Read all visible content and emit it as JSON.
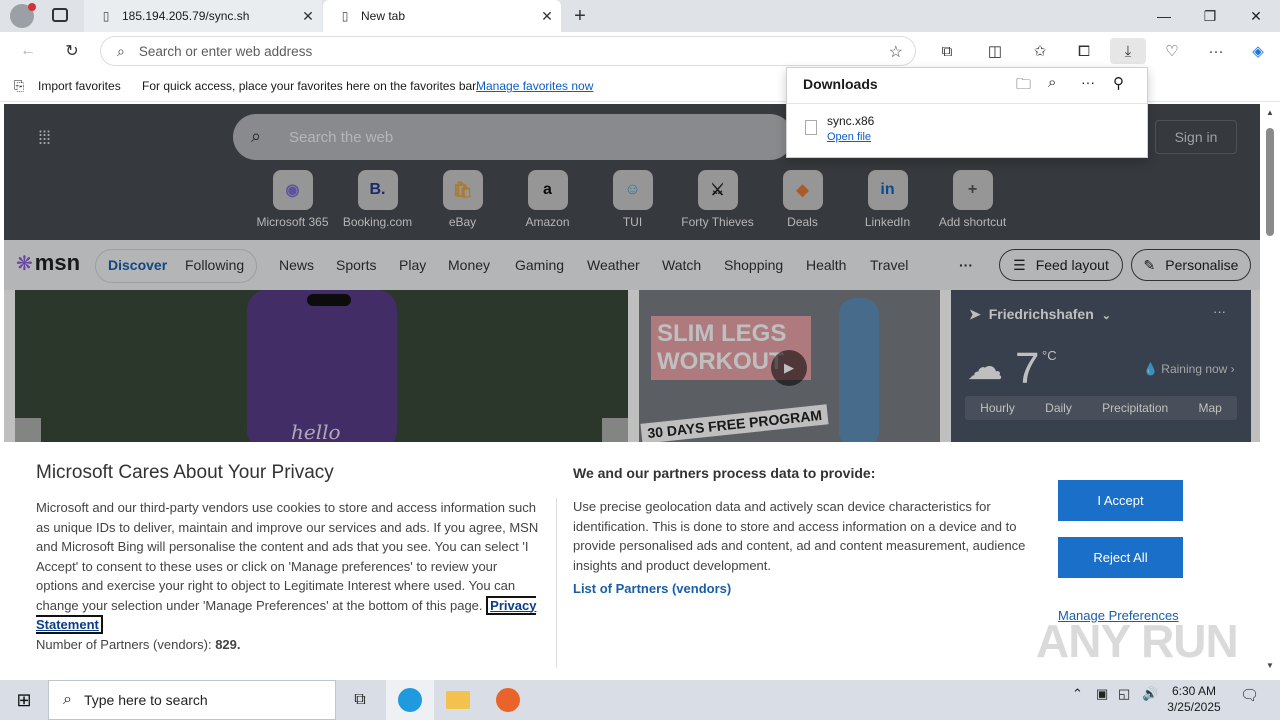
{
  "tabs": [
    {
      "label": "185.194.205.79/sync.sh",
      "icon": "page-icon"
    },
    {
      "label": "New tab",
      "icon": "page-icon"
    }
  ],
  "address": {
    "placeholder": "Search or enter web address"
  },
  "favbar": {
    "import": "Import favorites",
    "message": "For quick access, place your favorites here on the favorites bar.",
    "manage": "Manage favorites now"
  },
  "downloads": {
    "title": "Downloads",
    "filename": "sync.x86",
    "open_link": "Open file"
  },
  "hero": {
    "search_placeholder": "Search the web",
    "signin": "Sign in"
  },
  "shortcuts": [
    {
      "label": "Microsoft 365",
      "glyph": "◉",
      "color": "#7b6fd6"
    },
    {
      "label": "Booking.com",
      "glyph": "B.",
      "color": "#1f3a8a"
    },
    {
      "label": "eBay",
      "glyph": "🛍",
      "color": "#e8a33a"
    },
    {
      "label": "Amazon",
      "glyph": "a",
      "color": "#111111"
    },
    {
      "label": "TUI",
      "glyph": "☺",
      "color": "#3aa0d8"
    },
    {
      "label": "Forty Thieves",
      "glyph": "⚔",
      "color": "#222222"
    },
    {
      "label": "Deals",
      "glyph": "◆",
      "color": "#e07a3a"
    },
    {
      "label": "LinkedIn",
      "glyph": "in",
      "color": "#0a66c2"
    },
    {
      "label": "Add shortcut",
      "glyph": "+",
      "color": "#555555"
    }
  ],
  "msn": {
    "logo": "msn",
    "tab_discover": "Discover",
    "tab_following": "Following",
    "nav": [
      "News",
      "Sports",
      "Play",
      "Money",
      "Gaming",
      "Weather",
      "Watch",
      "Shopping",
      "Health",
      "Travel"
    ],
    "more": "···",
    "feed_layout": "Feed layout",
    "personalise": "Personalise"
  },
  "cards": {
    "phone_text": "hello",
    "promo_line1": "SLIM LEGS",
    "promo_line2": "WORKOUT",
    "promo_line3": "30 DAYS FREE PROGRAM"
  },
  "weather": {
    "location": "Friedrichshafen",
    "temp": "7",
    "unit": "°C",
    "status": "Raining now",
    "tabs": [
      "Hourly",
      "Daily",
      "Precipitation",
      "Map"
    ]
  },
  "privacy": {
    "title": "Microsoft Cares About Your Privacy",
    "body": "Microsoft and our third-party vendors use cookies to store and access information such as unique IDs to deliver, maintain and improve our services and ads. If you agree, MSN and Microsoft Bing will personalise the content and ads that you see. You can select 'I Accept' to consent to these uses or click on 'Manage preferences' to review your options and exercise your right to object to Legitimate Interest where used. You can change your selection under 'Manage Preferences' at the bottom of this page.",
    "statement_link": "Privacy Statement",
    "partners_label": "Number of Partners (vendors):",
    "partners_count": "829.",
    "title2": "We and our partners process data to provide:",
    "body2": "Use precise geolocation data and actively scan device characteristics for identification. This is done to store and access information on a device and to provide personalised ads and content, ad and content measurement, audience insights and product development.",
    "list_link": "List of Partners (vendors)",
    "accept": "I Accept",
    "reject": "Reject All",
    "manage": "Manage Preferences"
  },
  "taskbar": {
    "search_placeholder": "Type here to search",
    "time": "6:30 AM",
    "date": "3/25/2025"
  },
  "watermark": "ANY RUN"
}
